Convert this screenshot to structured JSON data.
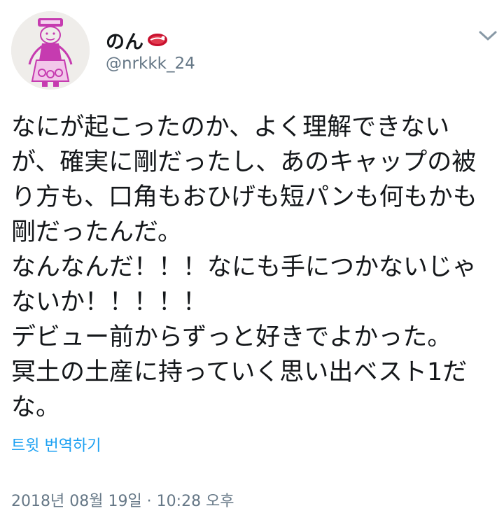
{
  "author": {
    "display_name": "のん",
    "name_emoji": "meat-emoji",
    "handle": "@nrkkk_24",
    "avatar_icon": "avatar-drawing-icon"
  },
  "menu": {
    "caret_icon": "chevron-down-icon"
  },
  "tweet": {
    "lines": [
      "なにが起こったのか、よく理解できない",
      "が、確実に剛だったし、あのキャップの被",
      "り方も、口角もおひげも短パンも何もかも",
      "剛だったんだ。",
      "なんなんだ！！！なにも手につかないじゃ",
      "ないか！！！！！",
      "デビュー前からずっと好きでよかった。",
      "冥土の土産に持っていく思い出ベスト1だ",
      "な。"
    ]
  },
  "translate_label": "트윗 번역하기",
  "timestamp": "2018년 08월 19일 · 10:28 오후",
  "colors": {
    "text": "#14171a",
    "secondary": "#657786",
    "link": "#1da1f2",
    "avatar_ink": "#c63bb0",
    "avatar_bg": "#efedea"
  }
}
